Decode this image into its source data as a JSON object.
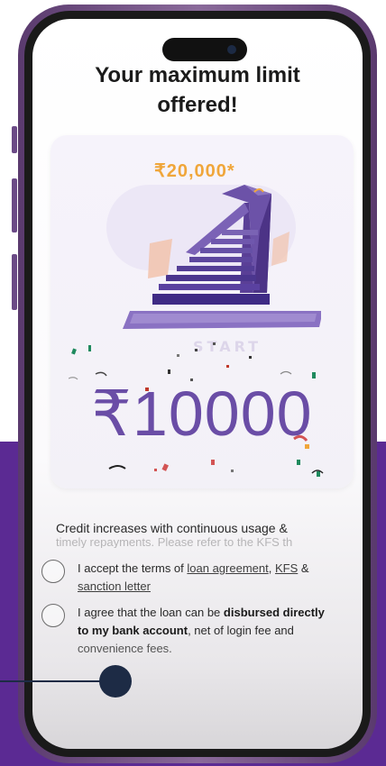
{
  "headline": {
    "line1": "Your maximum limit",
    "line2": "offered!"
  },
  "offer": {
    "max_limit": "₹20,000*",
    "offered_amount": "₹10000"
  },
  "credit_note": {
    "line1": "Credit increases with continuous usage &",
    "line2_partial": "timely repayments. Please refer to the KFS th"
  },
  "terms_checkbox": {
    "prefix": "I accept the terms of ",
    "loan_agreement": "loan agreement",
    "sep": ", ",
    "kfs": "KFS",
    "and": " & ",
    "sanction_letter": "sanction letter"
  },
  "disbursal_checkbox": {
    "prefix": "I agree that the loan can be ",
    "bold1": "disbursed directly",
    "bold2": "to my bank account",
    "suffix": ", net of login fee and",
    "line3": "convenience fees."
  },
  "colors": {
    "accent_purple": "#6a4da6",
    "background_purple": "#5b2a93",
    "limit_orange": "#f0a63a",
    "connector_navy": "#1d2b45"
  }
}
